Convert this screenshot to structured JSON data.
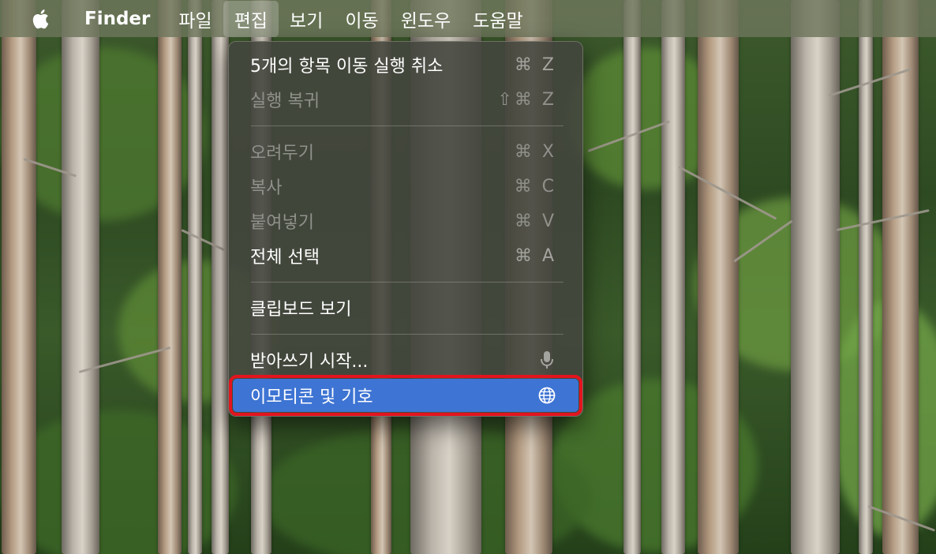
{
  "menubar": {
    "app_name": "Finder",
    "menus": [
      "파일",
      "편집",
      "보기",
      "이동",
      "윈도우",
      "도움말"
    ],
    "open_menu": "편집"
  },
  "edit_menu": {
    "items": [
      {
        "label": "5개의 항목 이동 실행 취소",
        "shortcut": "⌘ Z",
        "enabled": true
      },
      {
        "label": "실행 복귀",
        "shortcut": "⇧⌘ Z",
        "enabled": false
      },
      {
        "label": "오려두기",
        "shortcut": "⌘ X",
        "enabled": false
      },
      {
        "label": "복사",
        "shortcut": "⌘ C",
        "enabled": false
      },
      {
        "label": "붙여넣기",
        "shortcut": "⌘ V",
        "enabled": false
      },
      {
        "label": "전체 선택",
        "shortcut": "⌘ A",
        "enabled": true
      },
      {
        "label": "클립보드 보기",
        "shortcut": "",
        "enabled": true
      },
      {
        "label": "받아쓰기 시작...",
        "icon": "microphone-icon",
        "enabled": true
      },
      {
        "label": "이모티콘 및 기호",
        "icon": "globe-icon",
        "enabled": true,
        "highlighted": true
      }
    ]
  },
  "colors": {
    "highlight": "#3e74d3",
    "annotation_box": "#e3141e"
  }
}
